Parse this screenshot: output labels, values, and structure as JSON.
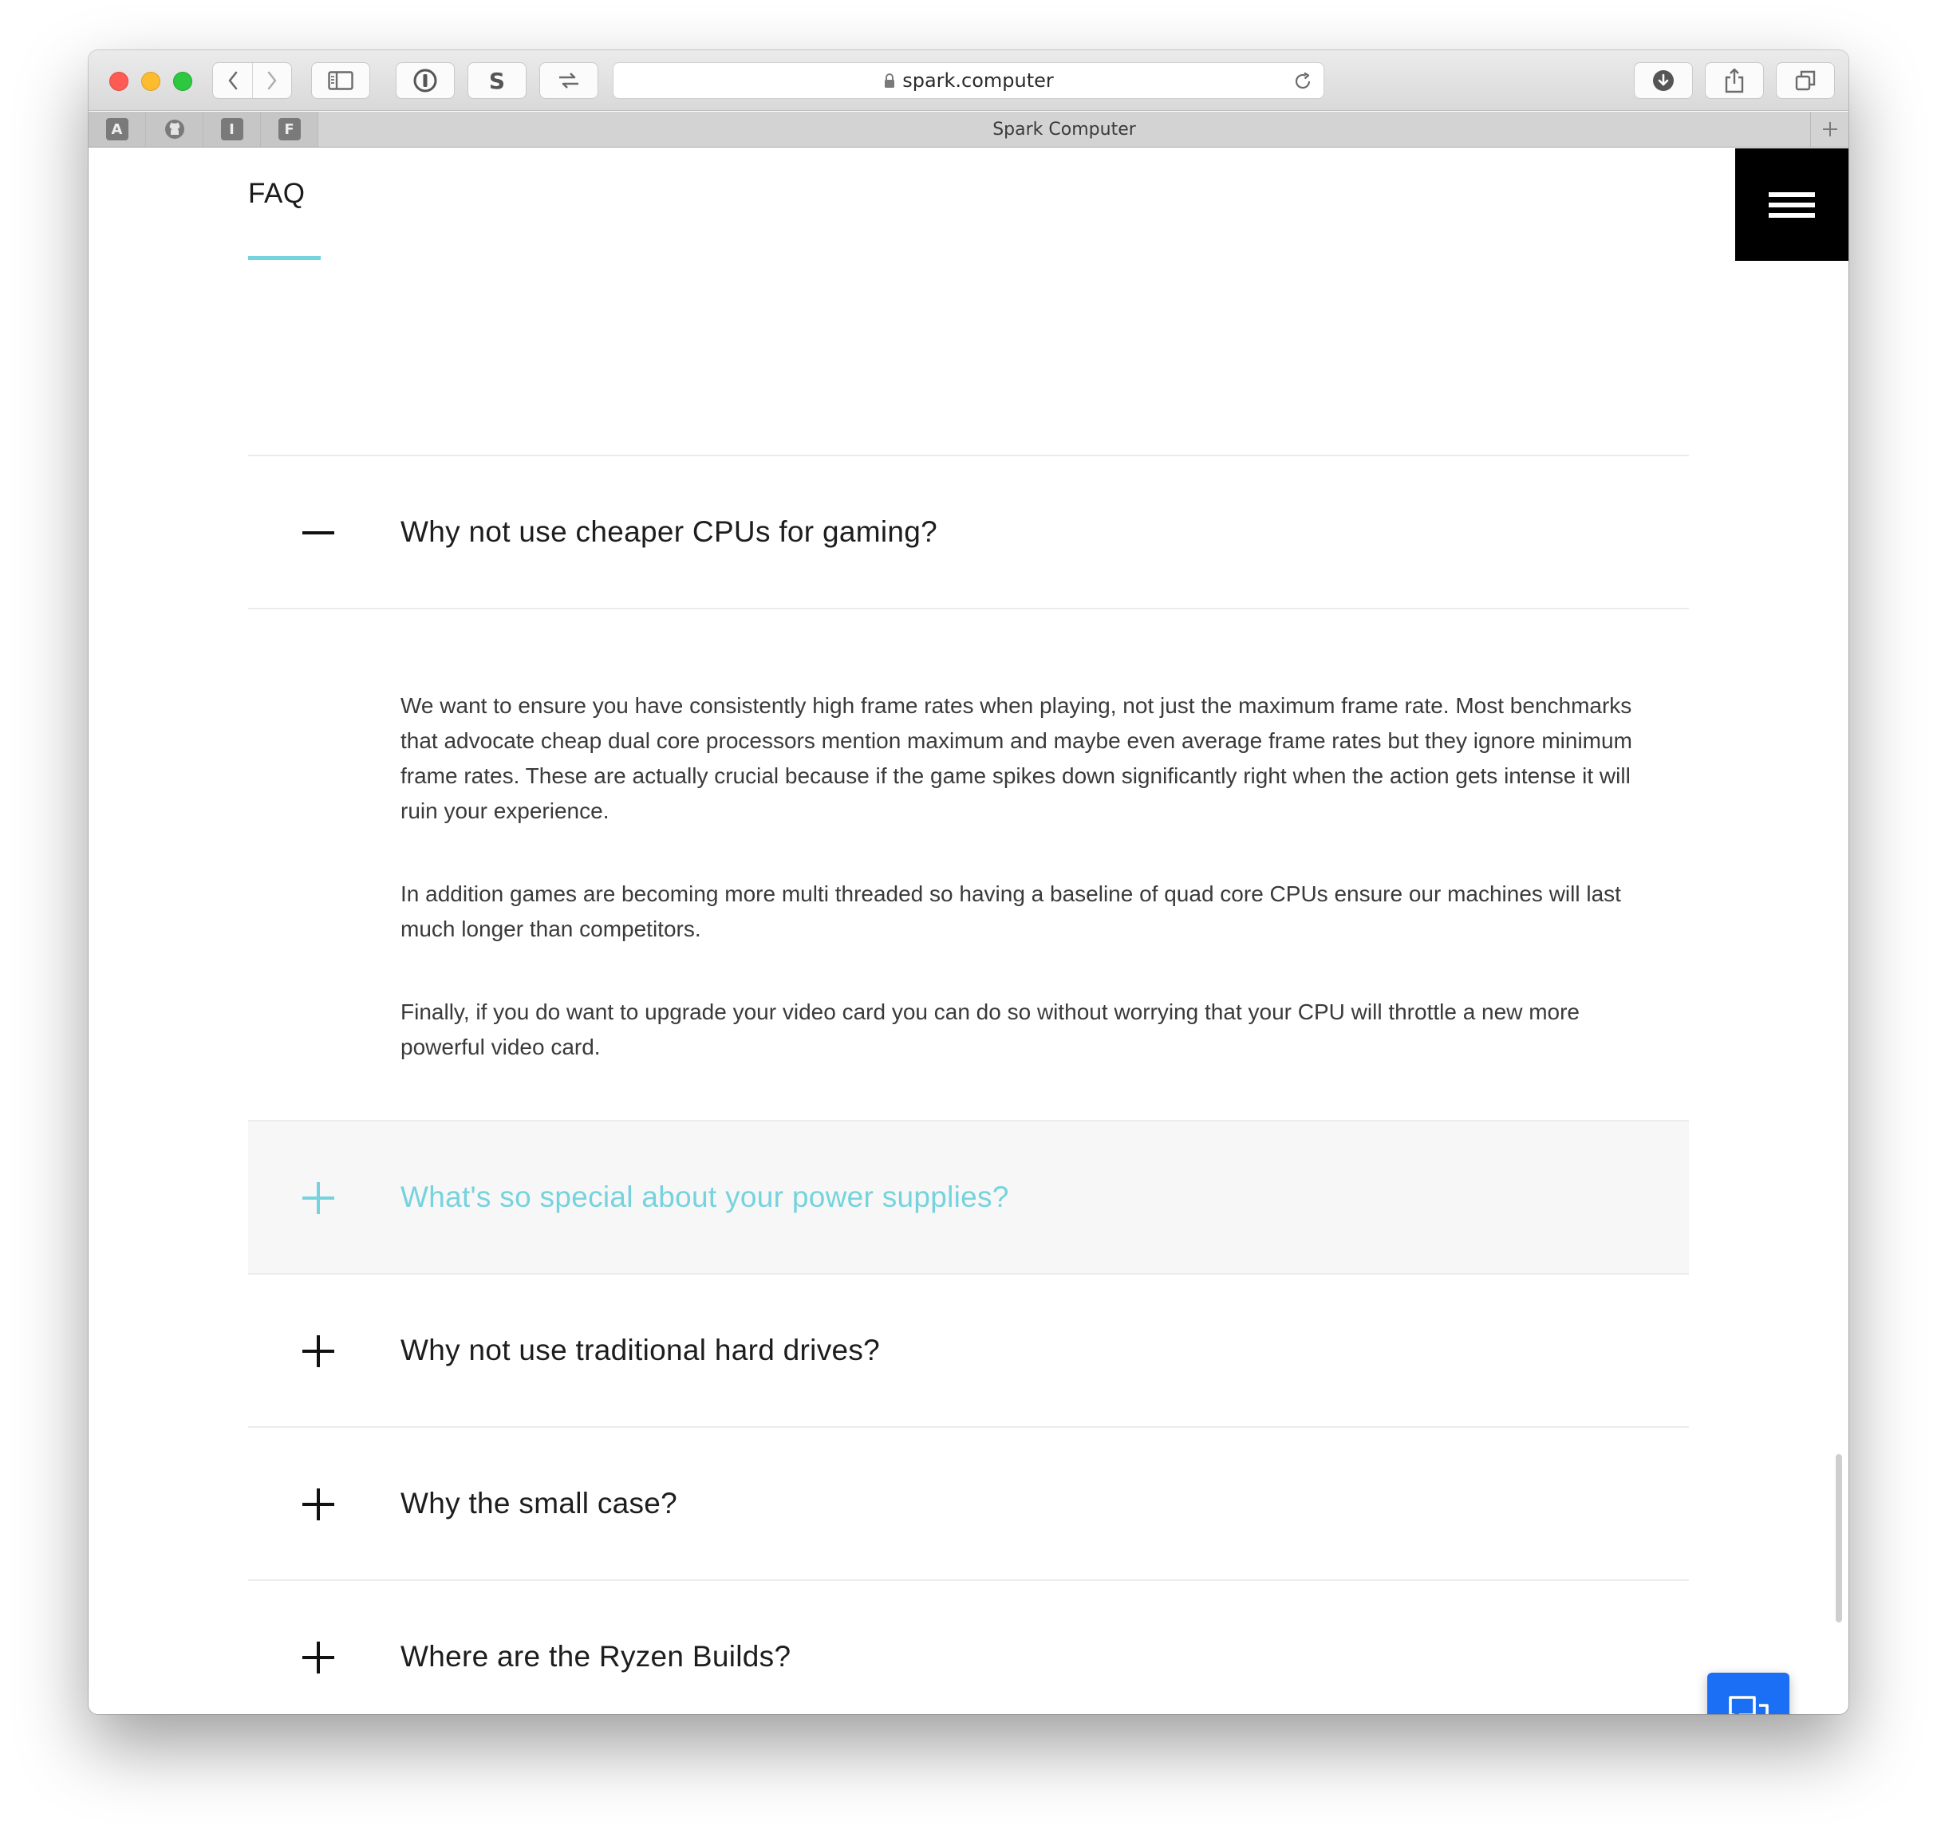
{
  "browser": {
    "url": "spark.computer",
    "tab_title": "Spark Computer",
    "pinned_tabs": [
      "A",
      "github",
      "I",
      "F"
    ]
  },
  "page": {
    "section_title": "FAQ",
    "accent_color": "#75d3dd",
    "faqs": [
      {
        "question": "Why not use cheaper CPUs for gaming?",
        "expanded": true,
        "answer": [
          "We want to ensure you have consistently high frame rates when playing, not just the maximum frame rate. Most benchmarks that advocate cheap dual core processors mention maximum and maybe even average frame rates but they ignore minimum frame rates. These are actually crucial because if the game spikes down significantly right when the action gets intense it will ruin your experience.",
          "In addition games are becoming more multi threaded so having a baseline of quad core CPUs ensure our machines will last much longer than competitors.",
          "Finally, if you do want to upgrade your video card you can do so without worrying that your CPU will throttle a new more powerful video card."
        ]
      },
      {
        "question": "What's so special about your power supplies?",
        "expanded": false,
        "hovered": true
      },
      {
        "question": "Why not use traditional hard drives?",
        "expanded": false
      },
      {
        "question": "Why the small case?",
        "expanded": false
      },
      {
        "question": "Where are the Ryzen Builds?",
        "expanded": false
      }
    ]
  }
}
